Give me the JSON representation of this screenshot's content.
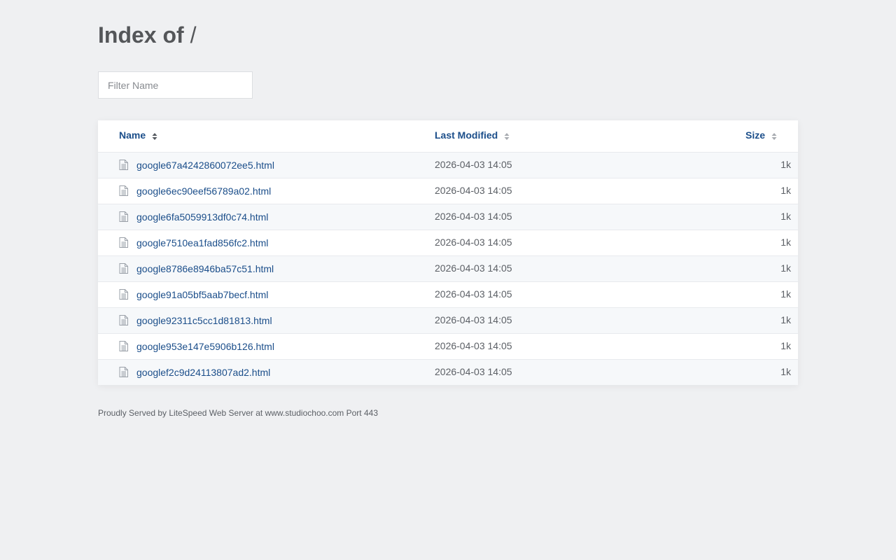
{
  "page": {
    "title_prefix": "Index of",
    "title_path": "/"
  },
  "filter": {
    "placeholder": "Filter Name",
    "value": ""
  },
  "table": {
    "columns": {
      "name": "Name",
      "last_modified": "Last Modified",
      "size": "Size"
    },
    "rows": [
      {
        "name": "google67a4242860072ee5.html",
        "modified": "2026-04-03 14:05",
        "size": "1k"
      },
      {
        "name": "google6ec90eef56789a02.html",
        "modified": "2026-04-03 14:05",
        "size": "1k"
      },
      {
        "name": "google6fa5059913df0c74.html",
        "modified": "2026-04-03 14:05",
        "size": "1k"
      },
      {
        "name": "google7510ea1fad856fc2.html",
        "modified": "2026-04-03 14:05",
        "size": "1k"
      },
      {
        "name": "google8786e8946ba57c51.html",
        "modified": "2026-04-03 14:05",
        "size": "1k"
      },
      {
        "name": "google91a05bf5aab7becf.html",
        "modified": "2026-04-03 14:05",
        "size": "1k"
      },
      {
        "name": "google92311c5cc1d81813.html",
        "modified": "2026-04-03 14:05",
        "size": "1k"
      },
      {
        "name": "google953e147e5906b126.html",
        "modified": "2026-04-03 14:05",
        "size": "1k"
      },
      {
        "name": "googlef2c9d24113807ad2.html",
        "modified": "2026-04-03 14:05",
        "size": "1k"
      }
    ]
  },
  "footer": {
    "text": "Proudly Served by LiteSpeed Web Server at www.studiochoo.com Port 443"
  },
  "icons": {
    "file": "file-document-icon",
    "sort": "sort-arrows-icon"
  },
  "colors": {
    "link": "#1b4e8a",
    "background": "#eff0f2",
    "row_alt": "#f6f8fa"
  }
}
